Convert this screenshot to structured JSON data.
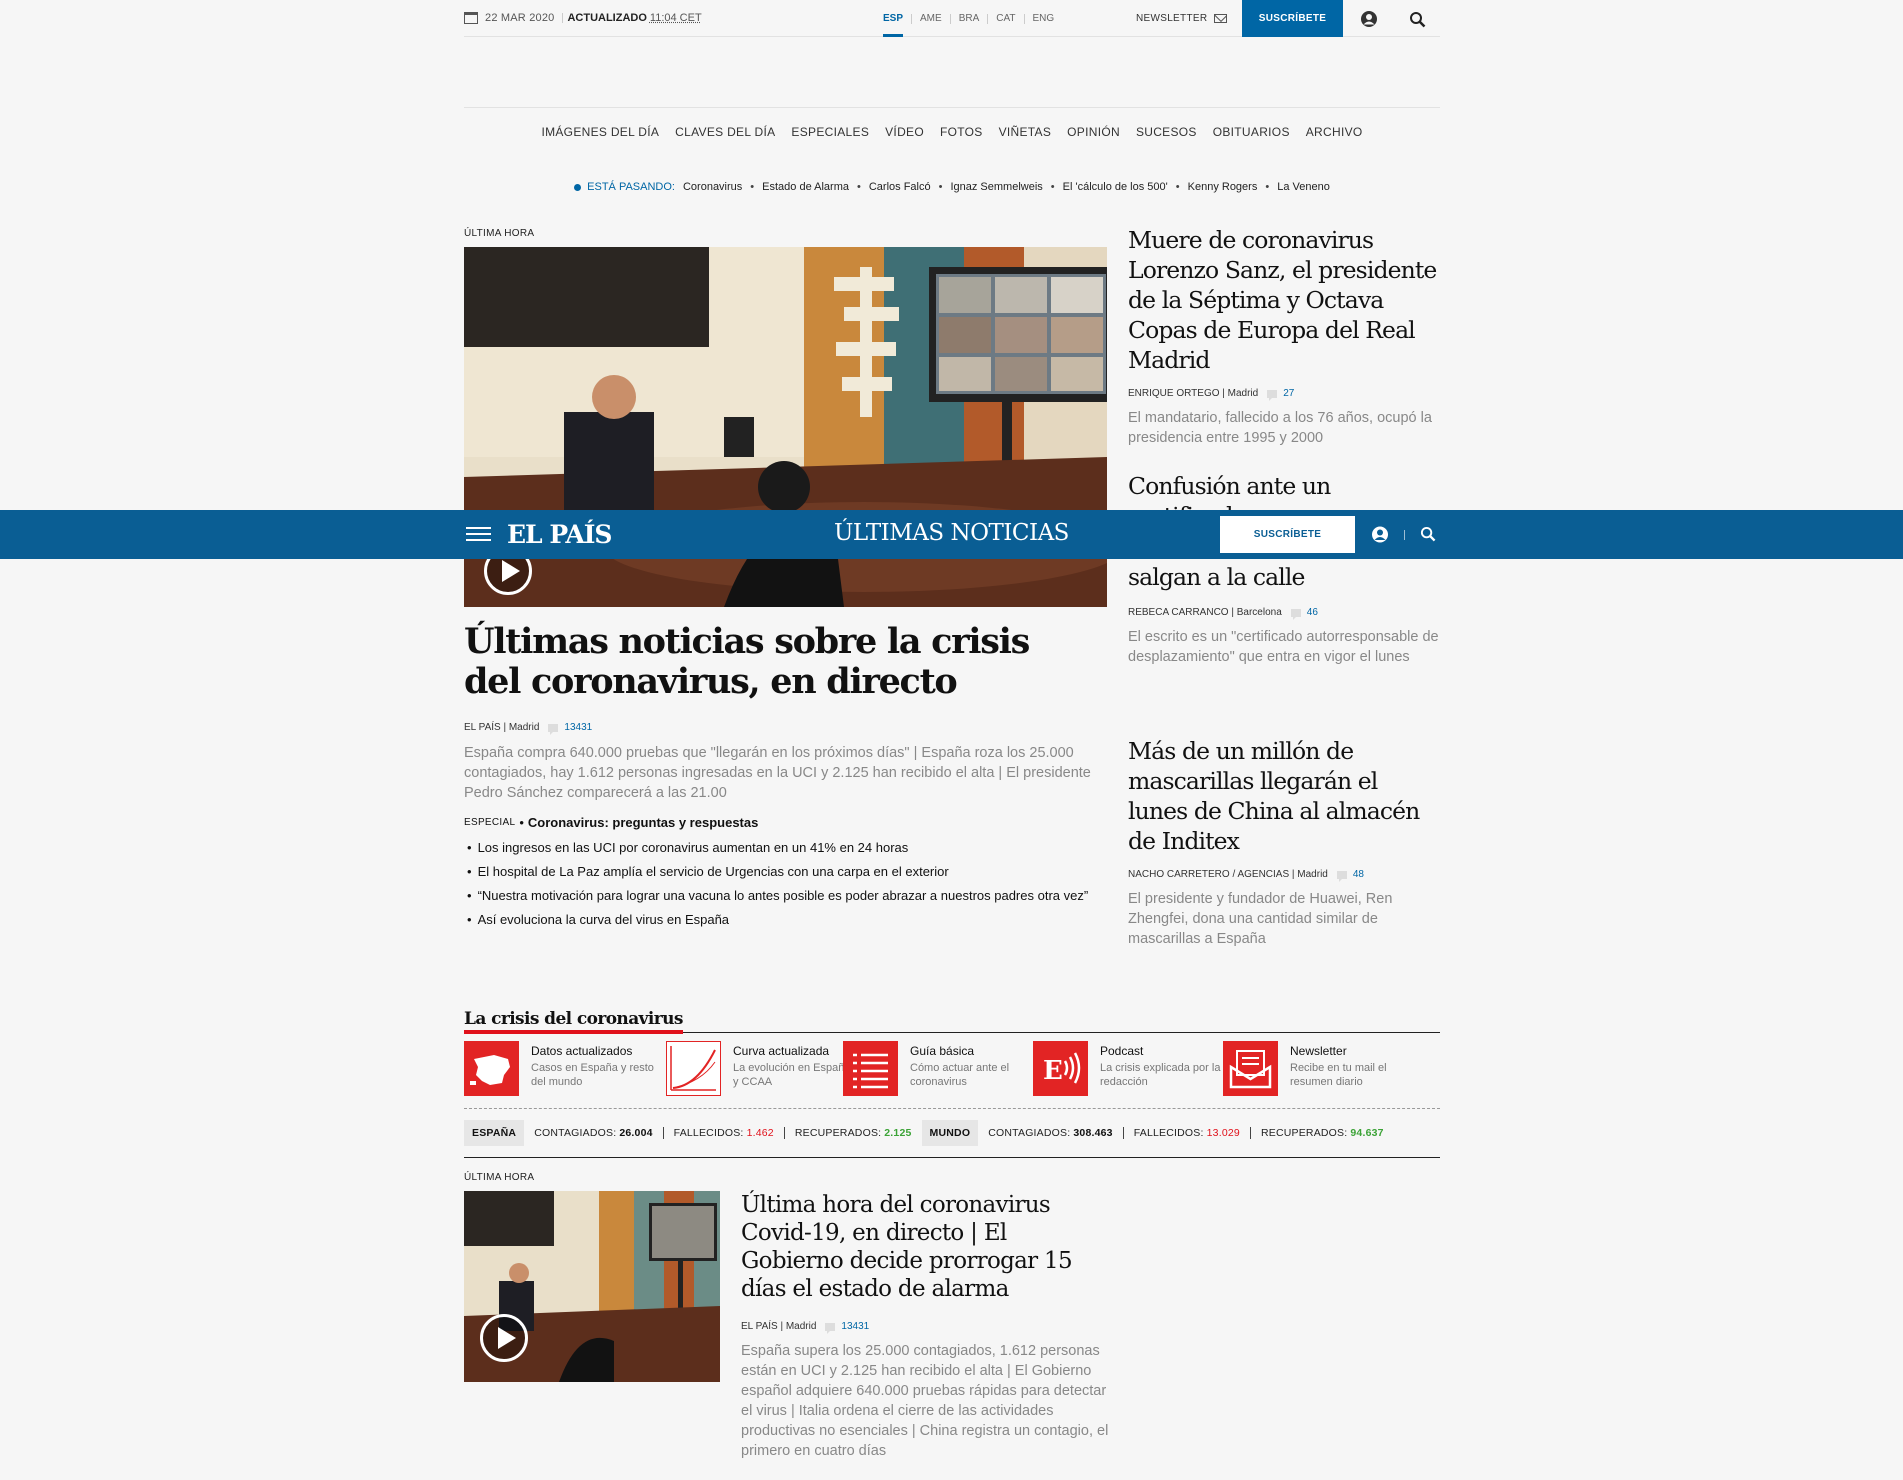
{
  "topbar": {
    "date": "22 MAR 2020",
    "updated_label": "ACTUALIZADO",
    "updated_time": "11:04 CET",
    "editions": [
      "ESP",
      "AME",
      "BRA",
      "CAT",
      "ENG"
    ],
    "active_edition": "ESP",
    "newsletter_label": "NEWSLETTER",
    "subscribe_label": "SUSCRÍBETE"
  },
  "nav": {
    "items": [
      "IMÁGENES DEL DÍA",
      "CLAVES DEL DÍA",
      "ESPECIALES",
      "VÍDEO",
      "FOTOS",
      "VIÑETAS",
      "OPINIÓN",
      "SUCESOS",
      "OBITUARIOS",
      "ARCHIVO"
    ]
  },
  "trending": {
    "label": "ESTÁ PASANDO:",
    "items": [
      "Coronavirus",
      "Estado de Alarma",
      "Carlos Falcó",
      "Ignaz Semmelweis",
      "El 'cálculo de los 500'",
      "Kenny Rogers",
      "La Veneno"
    ]
  },
  "lead": {
    "kicker": "ÚLTIMA HORA",
    "title": "Últimas noticias sobre la crisis del coronavirus, en directo",
    "author": "EL PAÍS | Madrid",
    "comments": "13431",
    "summary": "España compra 640.000 pruebas que \"llegarán en los próximos días\" | España roza los 25.000 contagiados, hay 1.612 personas ingresadas en la UCI y 2.125 han recibido el alta | El presidente Pedro Sánchez comparecerá a las 21.00",
    "especial_label": "ESPECIAL",
    "especial_link": "Coronavirus: preguntas y respuestas",
    "links": [
      "Los ingresos en las UCI por coronavirus aumentan en un 41% en 24 horas",
      "El hospital de La Paz amplía el servicio de Urgencias con una carpa en el exterior",
      "“Nuestra motivación para lograr una vacuna lo antes posible es poder abrazar a nuestros padres otra vez”",
      "Así evoluciona la curva del virus en España"
    ]
  },
  "side": [
    {
      "title": "Muere de coronavirus Lorenzo Sanz, el presidente de la Séptima y Octava Copas de Europa del Real Madrid",
      "author": "ENRIQUE ORTEGO | Madrid",
      "comments": "27",
      "summary": "El mandatario, fallecido a los 76 años, ocupó la presidencia entre 1995 y 2000"
    },
    {
      "title_top": "Confusión ante un certificado",
      "title_bottom": "salgan a la calle",
      "author": "REBECA CARRANCO | Barcelona",
      "comments": "46",
      "summary": "El escrito es un \"certificado autorresponsable de desplazamiento\" que entra en vigor el lunes"
    },
    {
      "title": "Más de un millón de mascarillas llegarán el lunes de China al almacén de Inditex",
      "author": "NACHO CARRETERO / AGENCIAS | Madrid",
      "comments": "48",
      "summary": "El presidente y fundador de Huawei, Ren Zhengfei, dona una cantidad similar de mascarillas a España"
    }
  ],
  "sticky": {
    "logo": "EL PAÍS",
    "title": "ÚLTIMAS NOTICIAS",
    "subscribe_label": "SUSCRÍBETE"
  },
  "crisis": {
    "title": "La crisis del coronavirus",
    "widgets": [
      {
        "title": "Datos actualizados",
        "sub": "Casos en España y resto del mundo",
        "icon": "spain-map-icon"
      },
      {
        "title": "Curva actualizada",
        "sub": "La evolución en España y CCAA",
        "icon": "curve-chart-icon"
      },
      {
        "title": "Guía básica",
        "sub": "Cómo actuar ante el coronavirus",
        "icon": "checklist-icon"
      },
      {
        "title": "Podcast",
        "sub": "La crisis explicada por la redacción",
        "icon": "podcast-icon"
      },
      {
        "title": "Newsletter",
        "sub": "Recibe en tu mail el resumen diario",
        "icon": "mail-icon"
      }
    ],
    "stats": {
      "spain_label": "ESPAÑA",
      "world_label": "MUNDO",
      "contagiados_label": "CONTAGIADOS:",
      "fallecidos_label": "FALLECIDOS:",
      "recuperados_label": "RECUPERADOS:",
      "spain_contagiados": "26.004",
      "spain_fallecidos": "1.462",
      "spain_recuperados": "2.125",
      "world_contagiados": "308.463",
      "world_fallecidos": "13.029",
      "world_recuperados": "94.637"
    },
    "colors": {
      "accent": "#e22424",
      "brand": "#0066a5",
      "recovered": "#3ca337"
    }
  },
  "second": {
    "kicker": "ÚLTIMA HORA",
    "title": "Última hora del coronavirus Covid-19, en directo | El Gobierno decide prorrogar 15 días el estado de alarma",
    "author": "EL PAÍS | Madrid",
    "comments": "13431",
    "summary": "España supera los 25.000 contagiados, 1.612 personas están en UCI y 2.125 han recibido el alta | El Gobierno español adquiere 640.000 pruebas rápidas para detectar el virus | Italia ordena el cierre de las actividades productivas no esenciales | China registra un contagio, el primero en cuatro días"
  }
}
